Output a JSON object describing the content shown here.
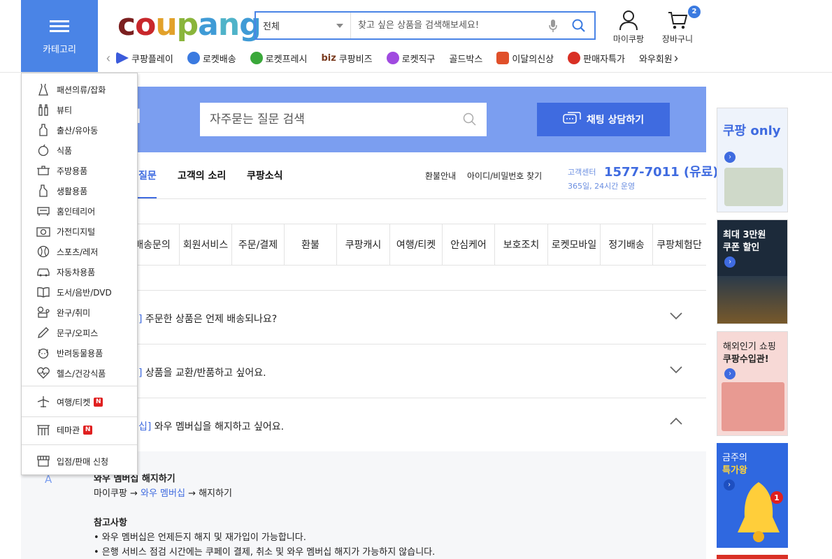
{
  "header": {
    "category_label": "카테고리",
    "logo": [
      "c",
      "o",
      "u",
      "p",
      "a",
      "n",
      "g"
    ],
    "search": {
      "scope": "전체",
      "placeholder": "찾고 싶은 상품을 검색해보세요!"
    },
    "mycoupang_label": "마이쿠팡",
    "cart_label": "장바구니",
    "cart_count": "2"
  },
  "quicknav": [
    {
      "label": "쿠팡플레이",
      "color": "#3b5bdb"
    },
    {
      "label": "로켓배송",
      "color": "#3a7ae0"
    },
    {
      "label": "로켓프레시",
      "color": "#3aa83a"
    },
    {
      "label": "쿠팡비즈",
      "color": "#7a3b1f"
    },
    {
      "label": "로켓직구",
      "color": "#a04ae0"
    },
    {
      "label": "골드박스",
      "color": ""
    },
    {
      "label": "이달의신상",
      "color": "#e0502a"
    },
    {
      "label": "판매자특가",
      "color": "#d93025"
    },
    {
      "label": "와우회원",
      "color": ""
    }
  ],
  "quicknav_biz_prefix": "biz",
  "banner": {
    "title_fragment": "H",
    "faq_search_placeholder": "자주묻는 질문 검색",
    "chat_button": "채팅 상담하기"
  },
  "tabs": [
    "질문",
    "고객의 소리",
    "쿠팡소식"
  ],
  "toplinks": [
    "환불안내",
    "아이디/비밀번호 찾기"
  ],
  "customer_center": {
    "label": "고객센터",
    "phone": "1577-7011 (유료)",
    "hours": "365일, 24시간 운영"
  },
  "categories": [
    "배송문의",
    "회원서비스",
    "주문/결제",
    "환불",
    "쿠팡캐시",
    "여행/티켓",
    "안심케어",
    "보호조치",
    "로켓모바일",
    "정기배송",
    "쿠팡체험단"
  ],
  "faq": [
    {
      "prefix": "]",
      "question": "주문한 상품은 언제 배송되나요?"
    },
    {
      "prefix": "]",
      "question": "상품을 교환/반품하고 싶어요."
    },
    {
      "prefix": "십]",
      "question": "와우 멤버십을 해지하고 싶어요."
    }
  ],
  "answer": {
    "marker": "A",
    "heading": "와우 멤버십 해지하기",
    "path_start": "마이쿠팡 → ",
    "path_link": "와우 멤버십",
    "path_end": " → 해지하기",
    "note_title": "참고사항",
    "note1": "• 와우 멤버십은 언제든지 해지 및 재가입이 가능합니다.",
    "note2": "• 은행 서비스 점검 시간에는 쿠페이 결제, 취소 및 와우 멤버십 해지가 가능하지 않습니다."
  },
  "ads": [
    {
      "line1": "쿠팡",
      "line2": "only",
      "bg": "#eef3fb"
    },
    {
      "line1": "최대 3만원",
      "line2": "쿠폰 할인",
      "bg": "#1c2a3a"
    },
    {
      "line1": "해외인기 쇼핑",
      "line2": "쿠팡수입관!",
      "bg": "#f7d9d6"
    },
    {
      "line1": "금주의",
      "line2": "특가왕",
      "bg": "#2f68e0"
    }
  ],
  "category_menu": {
    "items": [
      "패션의류/잡화",
      "뷰티",
      "출산/유아동",
      "식품",
      "주방용품",
      "생활용품",
      "홈인테리어",
      "가전디지털",
      "스포츠/레저",
      "자동차용품",
      "도서/음반/DVD",
      "완구/취미",
      "문구/오피스",
      "반려동물용품",
      "헬스/건강식품"
    ],
    "extra": [
      "여행/티켓",
      "테마관",
      "입점/판매 신청"
    ],
    "new_badge": "N"
  }
}
